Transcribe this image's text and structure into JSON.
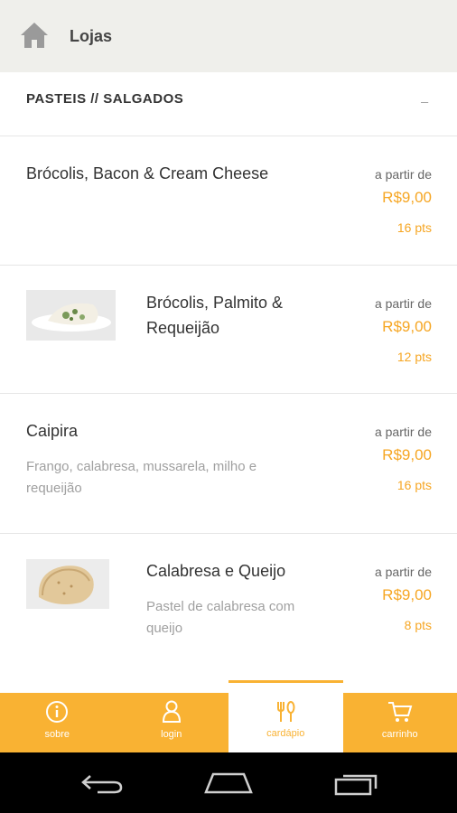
{
  "topbar": {
    "title": "Lojas",
    "icon": "home-icon"
  },
  "section": {
    "title": "PASTEIS // SALGADOS",
    "collapse": "_"
  },
  "items": [
    {
      "name": "Brócolis, Bacon & Cream Cheese",
      "description": "",
      "price_from": "a partir de",
      "price": "R$9,00",
      "points": "16 pts",
      "has_image": false
    },
    {
      "name": "Brócolis, Palmito & Requeijão",
      "description": "",
      "price_from": "a partir de",
      "price": "R$9,00",
      "points": "12 pts",
      "has_image": true
    },
    {
      "name": "Caipira",
      "description": "Frango, calabresa, mussarela, milho e requeijão",
      "price_from": "a partir de",
      "price": "R$9,00",
      "points": "16 pts",
      "has_image": false
    },
    {
      "name": "Calabresa e Queijo",
      "description": "Pastel de calabresa com queijo",
      "price_from": "a partir de",
      "price": "R$9,00",
      "points": "8 pts",
      "has_image": true
    }
  ],
  "bottom_nav": [
    {
      "label": "sobre",
      "icon": "info-icon",
      "active": false
    },
    {
      "label": "login",
      "icon": "user-icon",
      "active": false
    },
    {
      "label": "cardápio",
      "icon": "cutlery-icon",
      "active": true
    },
    {
      "label": "carrinho",
      "icon": "cart-icon",
      "active": false
    }
  ],
  "colors": {
    "accent": "#f9b233",
    "price": "#f6a623",
    "topbar": "#efefeb"
  }
}
